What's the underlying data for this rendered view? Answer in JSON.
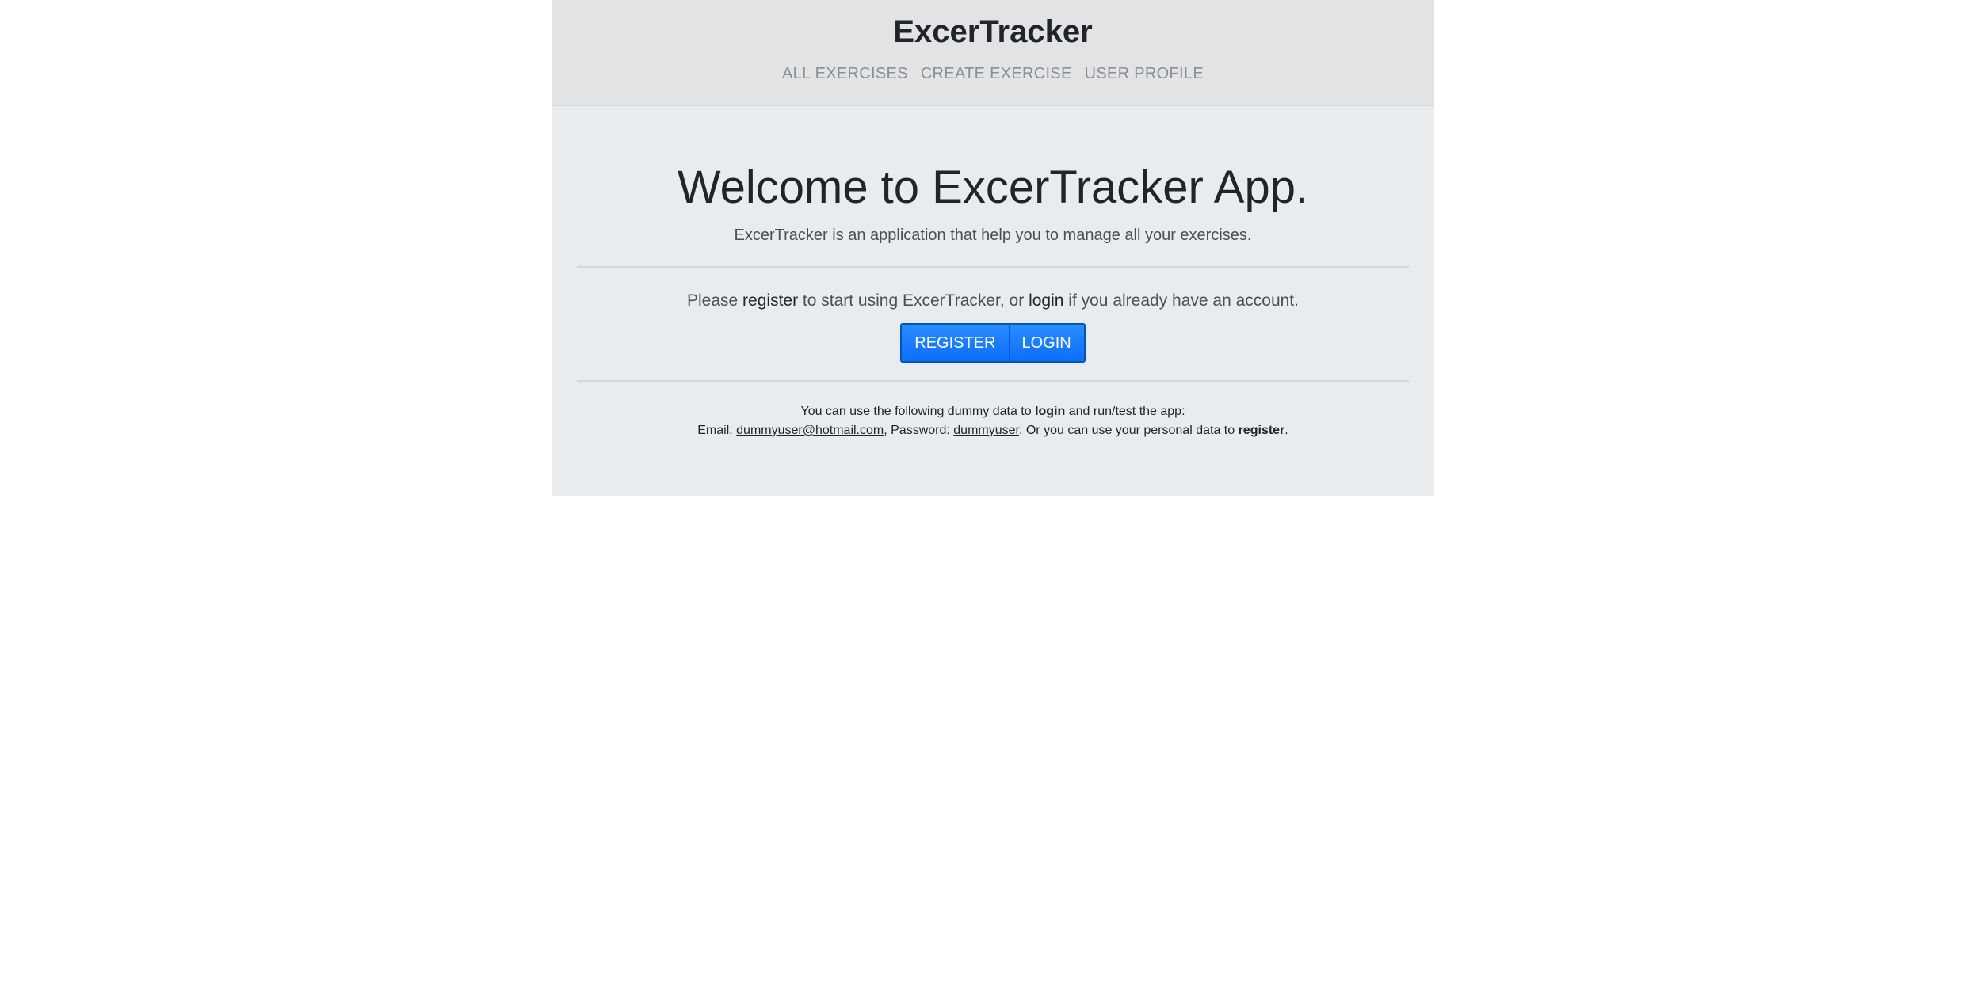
{
  "navbar": {
    "brand": "ExcerTracker",
    "links": [
      "ALL EXERCISES",
      "CREATE EXERCISE",
      "USER PROFILE"
    ]
  },
  "hero": {
    "title": "Welcome to ExcerTracker App.",
    "lead": "ExcerTracker is an application that help you to manage all your exercises."
  },
  "prompt": {
    "part1": "Please ",
    "register_word": "register",
    "part2": " to start using ExcerTracker, or ",
    "login_word": "login",
    "part3": " if you already have an account."
  },
  "buttons": {
    "register_label": "REGISTER",
    "login_label": "LOGIN"
  },
  "dummy": {
    "line1_part1": "You can use the following dummy data to ",
    "line1_bold": "login",
    "line1_part2": " and run/test the app:",
    "email_label": "Email: ",
    "email_value": "dummyuser@hotmail.com",
    "password_label": ", Password: ",
    "password_value": "dummyuser",
    "line2_part2": ". Or you can use your personal data to ",
    "line2_bold": "register",
    "line2_end": "."
  },
  "colors": {
    "page_bg": "#ffffff",
    "app_bg": "#e9ecef",
    "navbar_bg": "#e2e3e5",
    "button_primary": "#0d6efd"
  }
}
